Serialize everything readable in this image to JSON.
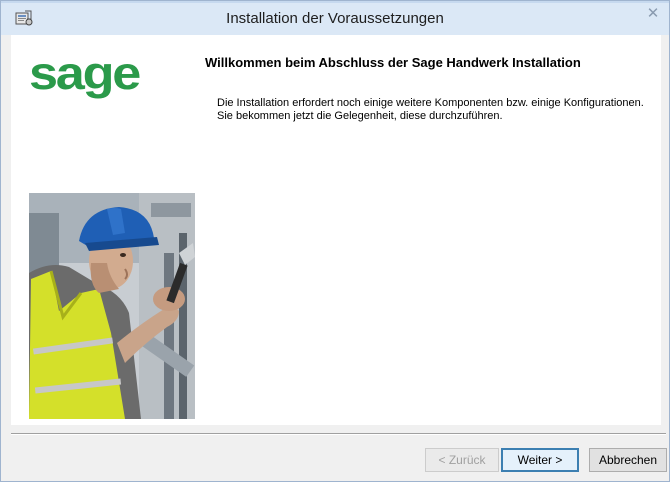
{
  "window": {
    "title": "Installation der Voraussetzungen",
    "close_label": "✕"
  },
  "brand": {
    "logo_text": "sage",
    "logo_color": "#2b9a4a"
  },
  "main": {
    "heading": "Willkommen beim Abschluss der Sage Handwerk Installation",
    "description": "Die Installation erfordert noch einige weitere Komponenten bzw. einige Konfigurationen. Sie bekommen jetzt die Gelegenheit, diese durchzuführen."
  },
  "buttons": {
    "back_label": "< Zurück",
    "next_label": "Weiter >",
    "cancel_label": "Abbrechen"
  },
  "colors": {
    "titlebar": "#dbe8f6",
    "default_button_border": "#3c7fb1",
    "helmet": "#1f5fb5",
    "vest": "#d4e02a"
  }
}
